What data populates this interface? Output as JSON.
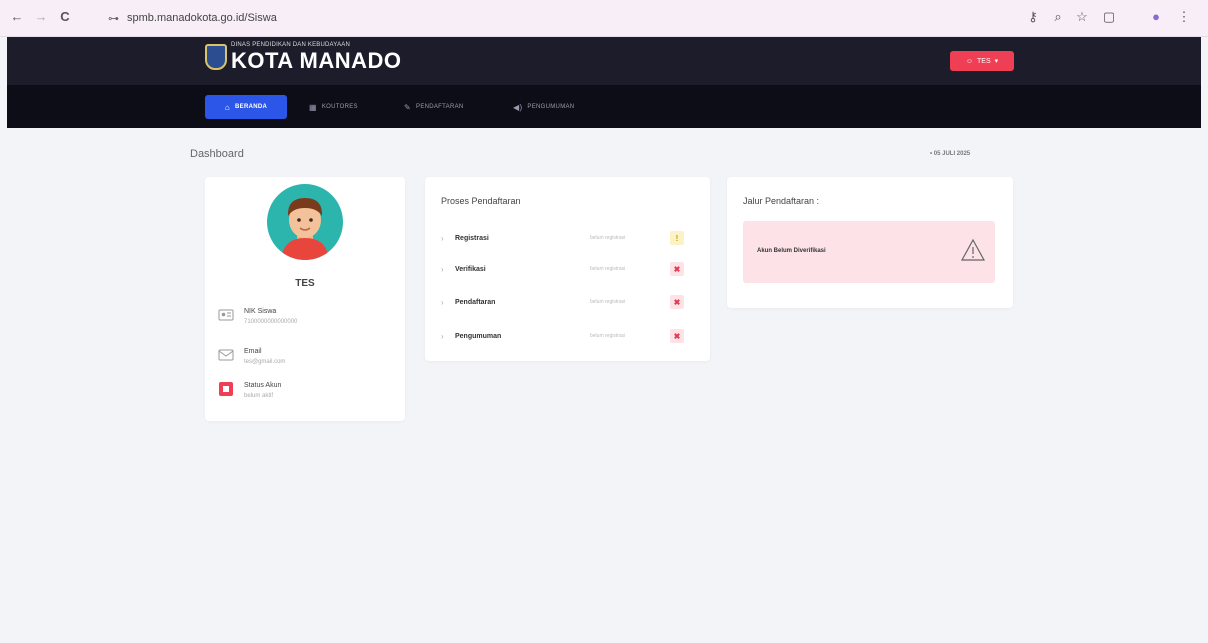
{
  "browser": {
    "back": "←",
    "forward": "→",
    "reload": "C",
    "url": "spmb.manadokota.go.id/Siswa"
  },
  "header": {
    "logo_small": "DINAS PENDIDIKAN DAN KEBUDAYAAN",
    "logo_big": "KOTA MANADO",
    "user_button": "TES"
  },
  "nav": {
    "items": [
      {
        "label": "BERANDA",
        "icon": "home-icon"
      },
      {
        "label": "KOUTORES",
        "icon": "grid-icon"
      },
      {
        "label": "PENDAFTARAN",
        "icon": "edit-icon"
      },
      {
        "label": "PENGUMUMAN",
        "icon": "megaphone-icon"
      }
    ]
  },
  "page": {
    "title": "Dashboard",
    "date": "• 05 JULI 2025"
  },
  "profile": {
    "name": "TES",
    "fields": [
      {
        "label": "NIK Siswa",
        "value": "7100000000000000"
      },
      {
        "label": "Email",
        "value": "tes@gmail.com"
      },
      {
        "label": "Status Akun",
        "value": "belum aktif"
      }
    ]
  },
  "proses": {
    "title": "Proses Pendaftaran",
    "steps": [
      {
        "name": "Registrasi",
        "status": "belum registrasi",
        "mark": "!"
      },
      {
        "name": "Verifikasi",
        "status": "belum registrasi",
        "mark": "✖"
      },
      {
        "name": "Pendaftaran",
        "status": "belum registrasi",
        "mark": "✖"
      },
      {
        "name": "Pengumuman",
        "status": "belum registrasi",
        "mark": "✖"
      }
    ]
  },
  "jalur": {
    "title": "Jalur Pendaftaran :",
    "alert": "Akun Belum Diverifikasi"
  },
  "colors": {
    "accent": "#2c56e8",
    "danger": "#ee3f55",
    "header_bg": "#1c1c2a",
    "nav_bg": "#0d0d17"
  }
}
